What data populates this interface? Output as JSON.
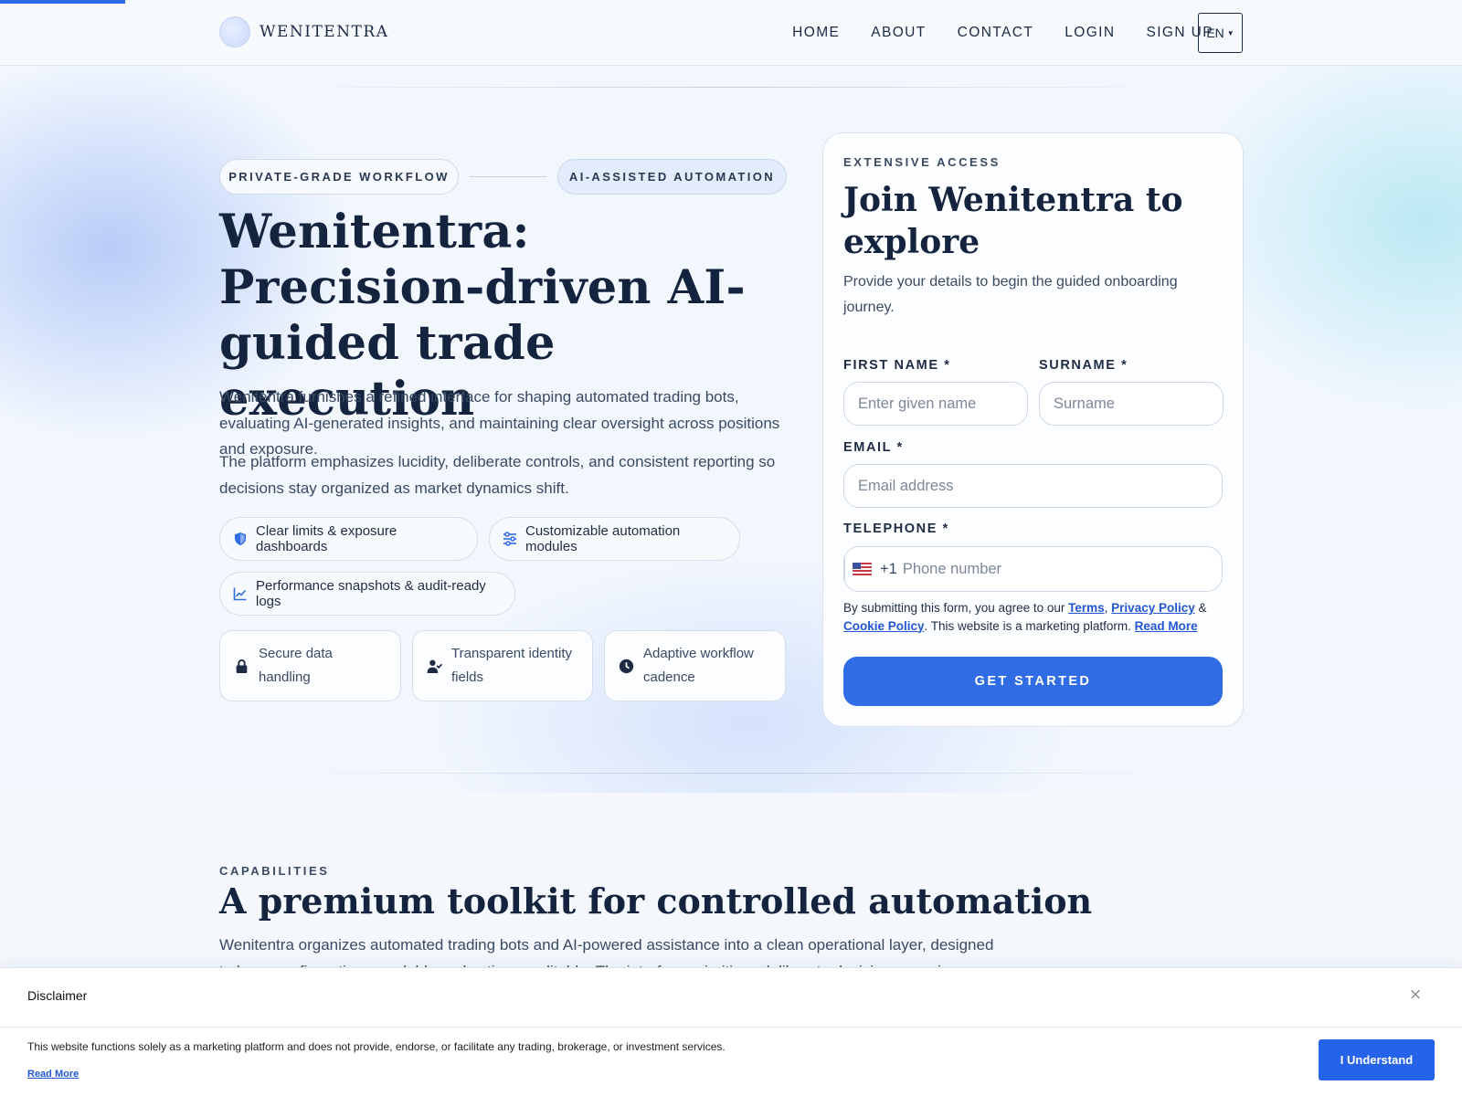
{
  "brand": {
    "name": "WENITENTRA"
  },
  "nav": {
    "items": [
      "HOME",
      "ABOUT",
      "CONTACT",
      "LOGIN",
      "SIGN UP"
    ],
    "language": "EN"
  },
  "hero": {
    "pills": [
      "PRIVATE-GRADE WORKFLOW",
      "AI-ASSISTED AUTOMATION"
    ],
    "title": "Wenitentra: Precision-driven AI-guided trade execution",
    "paragraph1": "Wenitentra furnishes a refined interface for shaping automated trading bots, evaluating AI-generated insights, and maintaining clear oversight across positions and exposure.",
    "paragraph2": "The platform emphasizes lucidity, deliberate controls, and consistent reporting so decisions stay organized as market dynamics shift.",
    "features": [
      {
        "label": "Clear limits & exposure dashboards",
        "icon": "shield-icon"
      },
      {
        "label": "Customizable automation modules",
        "icon": "sliders-icon"
      },
      {
        "label": "Performance snapshots & audit-ready logs",
        "icon": "line-chart-icon"
      }
    ],
    "cards": [
      {
        "label": "Secure data handling",
        "icon": "lock-icon"
      },
      {
        "label": "Transparent identity fields",
        "icon": "user-check-icon"
      },
      {
        "label": "Adaptive workflow cadence",
        "icon": "clock-icon"
      }
    ]
  },
  "form": {
    "eyebrow": "EXTENSIVE ACCESS",
    "title": "Join Wenitentra to explore",
    "subtitle": "Provide your details to begin the guided onboarding journey.",
    "first_name_label": "FIRST NAME *",
    "first_name_placeholder": "Enter given name",
    "surname_label": "SURNAME *",
    "surname_placeholder": "Surname",
    "email_label": "EMAIL *",
    "email_placeholder": "Email address",
    "telephone_label": "TELEPHONE *",
    "telephone_code": "+1",
    "telephone_placeholder": "Phone number",
    "consent_prefix": "By submitting this form, you agree to our ",
    "consent_terms": "Terms",
    "consent_sep1": ", ",
    "consent_privacy": "Privacy Policy",
    "consent_sep2": " & ",
    "consent_cookie": "Cookie Policy",
    "consent_mid": ". This website is a marketing platform. ",
    "consent_read_more": "Read More",
    "submit_label": "GET STARTED"
  },
  "capabilities": {
    "eyebrow": "CAPABILITIES",
    "title": "A premium toolkit for controlled automation",
    "paragraph": "Wenitentra organizes automated trading bots and AI-powered assistance into a clean operational layer, designed to keep configurations readable and actions auditable. The interface prioritizes deliberate decisions, precise parameters, and consistent"
  },
  "disclaimer": {
    "title": "Disclaimer",
    "close": "×",
    "text": "This website functions solely as a marketing platform and does not provide, endorse, or facilitate any trading, brokerage, or investment services.",
    "read_more": "Read More",
    "button": "I Understand"
  },
  "colors": {
    "accent": "#2f6ce5",
    "heading": "#14233e",
    "body": "#3a4a63",
    "link": "#2157d4"
  }
}
